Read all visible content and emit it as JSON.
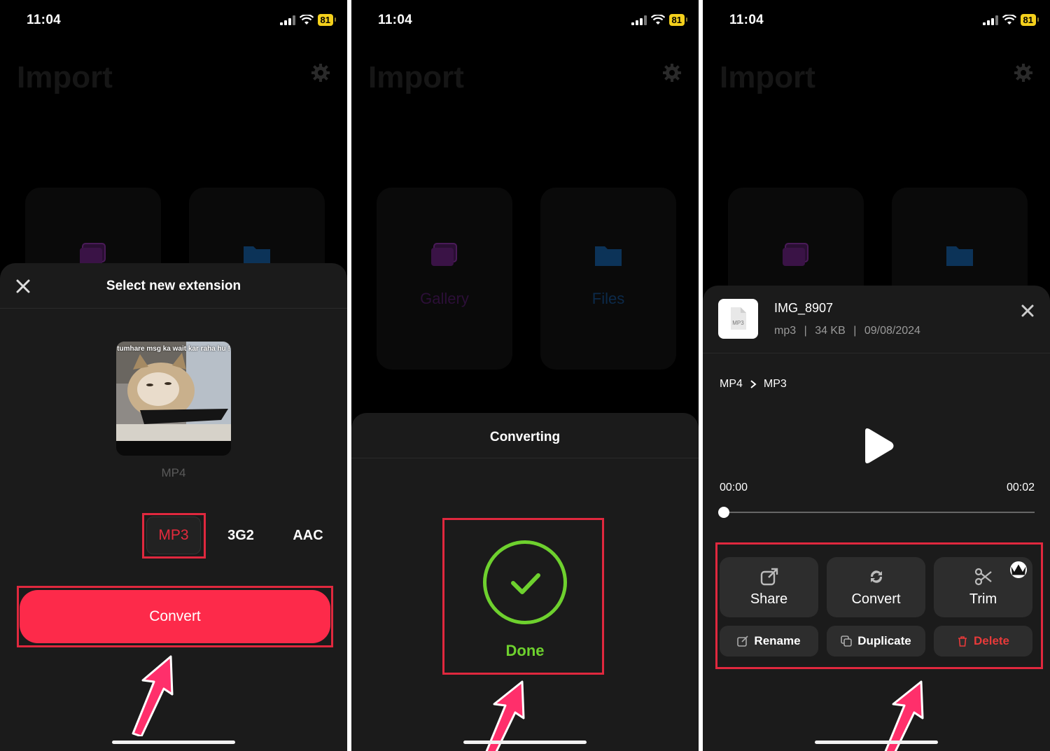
{
  "status_bar": {
    "time": "11:04",
    "battery": "81"
  },
  "background": {
    "title": "Import",
    "gallery_label": "Gallery",
    "files_label": "Files"
  },
  "screen1": {
    "sheet_title": "Select new extension",
    "thumbnail_caption": "tumhare msg ka wait kar raha hu !",
    "source_format": "MP4",
    "formats": [
      "MP3",
      "3G2",
      "AAC"
    ],
    "selected_format": "MP3",
    "convert_label": "Convert"
  },
  "screen2": {
    "sheet_title": "Converting",
    "done_label": "Done"
  },
  "screen3": {
    "file_icon_label": "MP3",
    "file_name": "IMG_8907",
    "file_type": "mp3",
    "file_size": "34 KB",
    "file_date": "09/08/2024",
    "meta_separator": "|",
    "from_format": "MP4",
    "to_format": "MP3",
    "time_start": "00:00",
    "time_end": "00:02",
    "playback_progress": 0,
    "actions": {
      "share": "Share",
      "convert": "Convert",
      "trim": "Trim",
      "rename": "Rename",
      "duplicate": "Duplicate",
      "delete": "Delete"
    }
  },
  "colors": {
    "accent_red": "#fd2a4a",
    "highlight_border": "#e0283e",
    "success_green": "#6ed12e",
    "battery_yellow": "#f4d01c",
    "danger_red": "#e83a3a"
  }
}
